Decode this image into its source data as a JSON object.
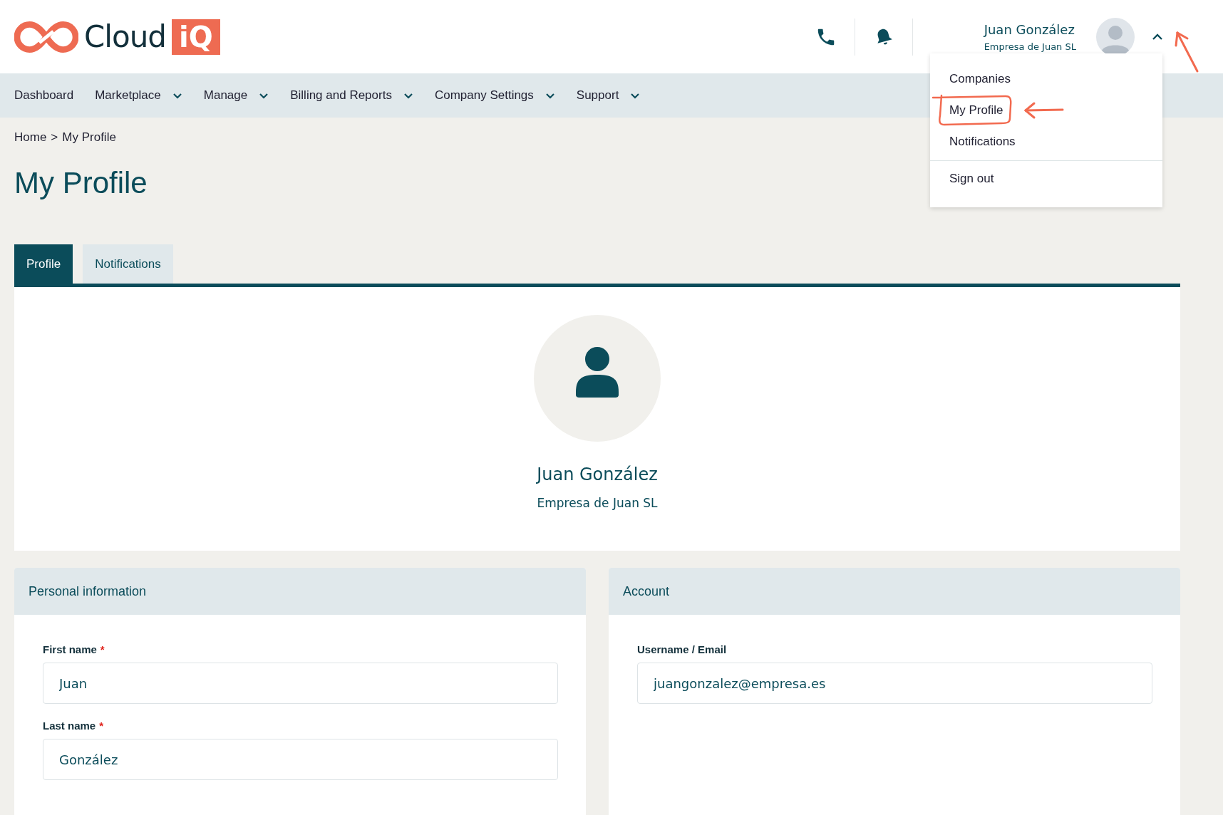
{
  "logo": {
    "text": "Cloud",
    "badge": "iQ"
  },
  "header": {
    "user_name": "Juan González",
    "company": "Empresa de Juan SL",
    "menu_open": true,
    "toggle_annotated": true
  },
  "nav": [
    {
      "label": "Dashboard",
      "dropdown": false
    },
    {
      "label": "Marketplace",
      "dropdown": true
    },
    {
      "label": "Manage",
      "dropdown": true
    },
    {
      "label": "Billing and Reports",
      "dropdown": true
    },
    {
      "label": "Company Settings",
      "dropdown": true
    },
    {
      "label": "Support",
      "dropdown": true
    }
  ],
  "user_menu": [
    {
      "label": "Companies",
      "divider_before": false,
      "annotated": false
    },
    {
      "label": "My Profile",
      "divider_before": false,
      "annotated": true
    },
    {
      "label": "Notifications",
      "divider_before": false,
      "annotated": false
    },
    {
      "label": "Sign out",
      "divider_before": true,
      "annotated": false
    }
  ],
  "breadcrumb": {
    "items": [
      "Home",
      "My Profile"
    ],
    "separator": ">"
  },
  "page_title": "My Profile",
  "required_marker": "*",
  "tabs": [
    {
      "label": "Profile",
      "selected": true
    },
    {
      "label": "Notifications",
      "selected": false
    }
  ],
  "profile": {
    "name": "Juan González",
    "company": "Empresa de Juan SL"
  },
  "panels": [
    {
      "title": "Personal information",
      "fields": [
        {
          "label": "First name",
          "required": true,
          "value": "Juan"
        },
        {
          "label": "Last name",
          "required": true,
          "value": "González"
        }
      ]
    },
    {
      "title": "Account",
      "fields": [
        {
          "label": "Username / Email",
          "required": false,
          "value": "juangonzalez@empresa.es"
        }
      ]
    }
  ]
}
